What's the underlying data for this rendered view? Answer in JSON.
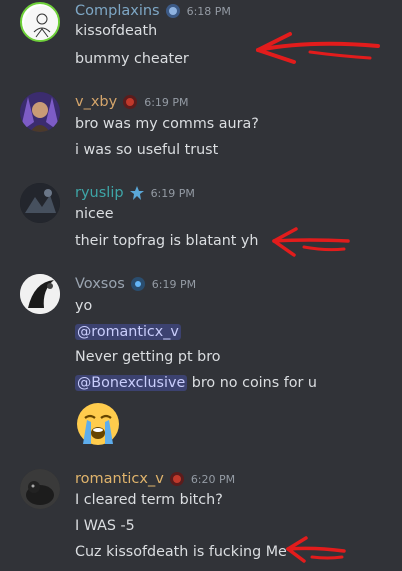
{
  "messages": [
    {
      "username": "Complaxins",
      "username_color": "#7ea7c5",
      "time": "6:18 PM",
      "lines": [
        "kissofdeath",
        "bummy cheater"
      ]
    },
    {
      "username": "v_xby",
      "username_color": "#d4a56b",
      "time": "6:19 PM",
      "lines": [
        "bro was my comms aura?",
        "i was so useful trust"
      ]
    },
    {
      "username": "ryuslip",
      "username_color": "#3ea5a7",
      "time": "6:19 PM",
      "lines": [
        "nicee",
        "their topfrag is blatant yh"
      ]
    },
    {
      "username": "Voxsos",
      "username_color": "#9aa4b0",
      "time": "6:19 PM",
      "lines": [
        "yo"
      ],
      "mention_1": "@romanticx_v",
      "line_after_mention": "Never getting pt bro",
      "mention_2": "@Bonexclusive",
      "mention_2_tail": " bro no coins for u",
      "emoji": "loudly-crying-face"
    },
    {
      "username": "romanticx_v",
      "username_color": "#e0b46c",
      "time": "6:20 PM",
      "lines": [
        "I cleared term bitch?",
        "I WAS -5",
        "Cuz kissofdeath is fucking Me"
      ]
    }
  ],
  "annotation_color": "#e21c1c"
}
